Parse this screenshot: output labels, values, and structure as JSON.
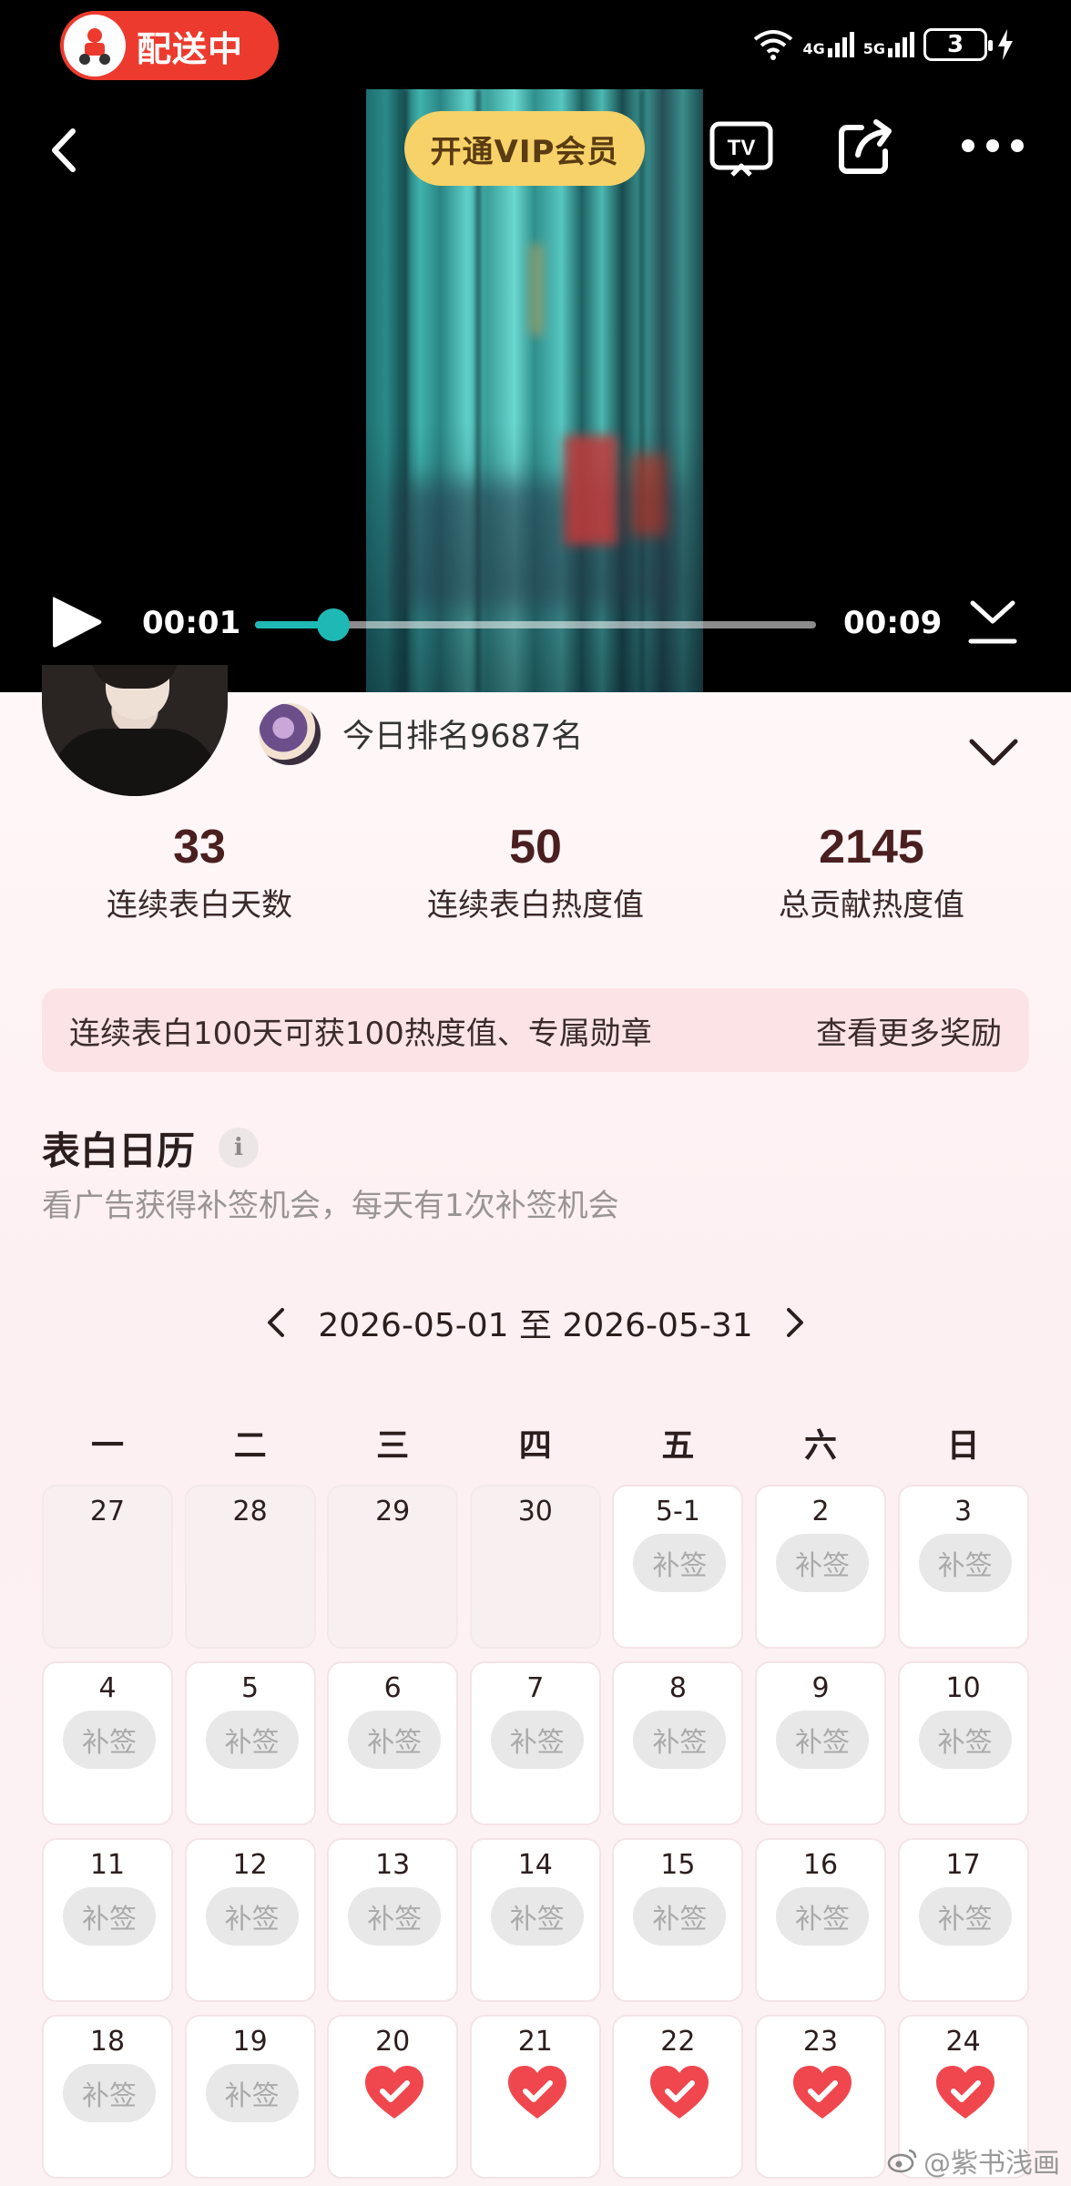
{
  "status_bar": {
    "delivery_label": "配送中",
    "signal_4g": "4G",
    "signal_5g": "5G",
    "battery": "3"
  },
  "video": {
    "vip_button": "开通VIP会员",
    "tv_label": "TV",
    "current_time": "00:01",
    "total_time": "00:09",
    "progress_fraction": 0.14
  },
  "profile": {
    "rank_text": "今日排名9687名"
  },
  "stats": [
    {
      "value": "33",
      "label": "连续表白天数"
    },
    {
      "value": "50",
      "label": "连续表白热度值"
    },
    {
      "value": "2145",
      "label": "总贡献热度值"
    }
  ],
  "reward": {
    "text": "连续表白100天可获100热度值、专属勋章",
    "more": "查看更多奖励"
  },
  "calendar": {
    "title": "表白日历",
    "info_icon": "i",
    "subtitle": "看广告获得补签机会，每天有1次补签机会",
    "range": "2026-05-01 至 2026-05-31",
    "weekdays": [
      "一",
      "二",
      "三",
      "四",
      "五",
      "六",
      "日"
    ],
    "makeup_label": "补签",
    "days": [
      {
        "day": "27",
        "state": "muted"
      },
      {
        "day": "28",
        "state": "muted"
      },
      {
        "day": "29",
        "state": "muted"
      },
      {
        "day": "30",
        "state": "muted"
      },
      {
        "day": "5-1",
        "state": "makeup"
      },
      {
        "day": "2",
        "state": "makeup"
      },
      {
        "day": "3",
        "state": "makeup"
      },
      {
        "day": "4",
        "state": "makeup"
      },
      {
        "day": "5",
        "state": "makeup"
      },
      {
        "day": "6",
        "state": "makeup"
      },
      {
        "day": "7",
        "state": "makeup"
      },
      {
        "day": "8",
        "state": "makeup"
      },
      {
        "day": "9",
        "state": "makeup"
      },
      {
        "day": "10",
        "state": "makeup"
      },
      {
        "day": "11",
        "state": "makeup"
      },
      {
        "day": "12",
        "state": "makeup"
      },
      {
        "day": "13",
        "state": "makeup"
      },
      {
        "day": "14",
        "state": "makeup"
      },
      {
        "day": "15",
        "state": "makeup"
      },
      {
        "day": "16",
        "state": "makeup"
      },
      {
        "day": "17",
        "state": "makeup"
      },
      {
        "day": "18",
        "state": "makeup"
      },
      {
        "day": "19",
        "state": "makeup"
      },
      {
        "day": "20",
        "state": "checked"
      },
      {
        "day": "21",
        "state": "checked"
      },
      {
        "day": "22",
        "state": "checked"
      },
      {
        "day": "23",
        "state": "checked"
      },
      {
        "day": "24",
        "state": "checked"
      }
    ]
  },
  "watermark": "@紫书浅画",
  "colors": {
    "accent_teal": "#1fb9b5",
    "vip_gold": "#f6d268",
    "delivery_red": "#ec3b2e",
    "heart_red": "#f0474f"
  }
}
